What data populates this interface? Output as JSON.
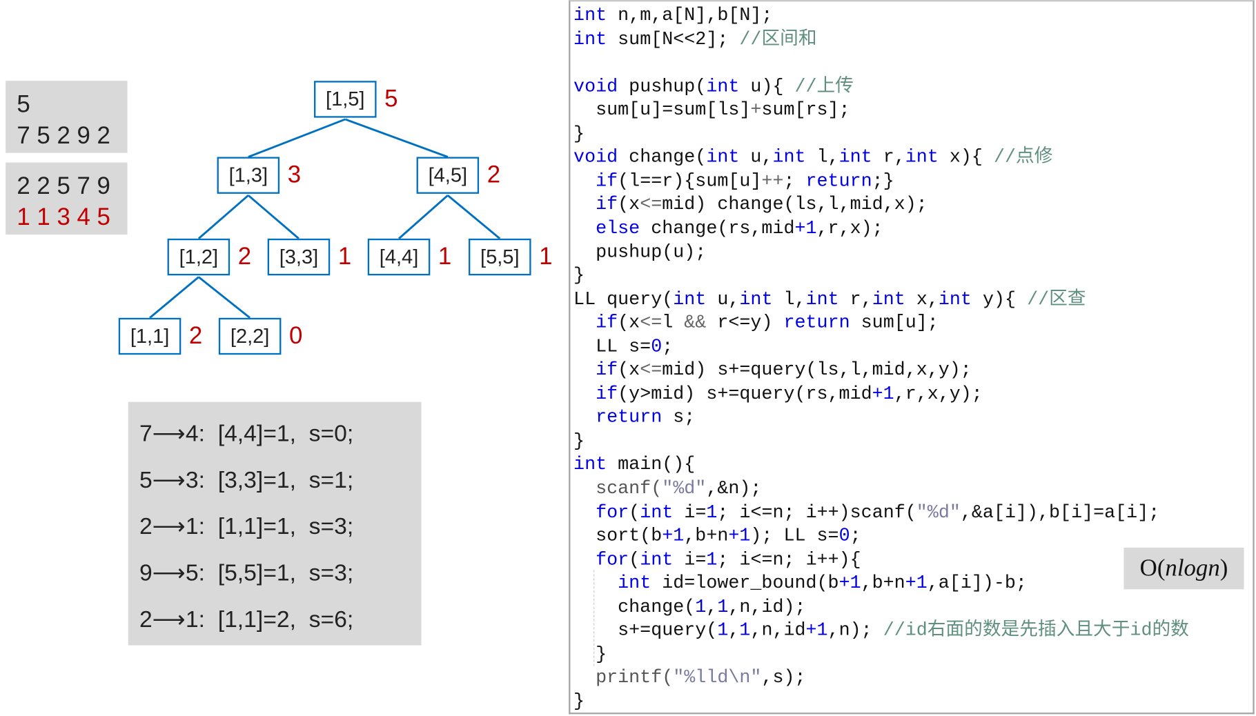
{
  "input": {
    "n": "5",
    "values": "7 5 2 9 2"
  },
  "sorted": {
    "values": "2 2 5 7 9",
    "ranks": "1 1 3 4 5"
  },
  "tree": {
    "colors": {
      "box": "#0070c0",
      "count": "#c00000"
    },
    "nodes": [
      {
        "range": "[1,5]",
        "count": "5"
      },
      {
        "range": "[1,3]",
        "count": "3"
      },
      {
        "range": "[4,5]",
        "count": "2"
      },
      {
        "range": "[1,2]",
        "count": "2"
      },
      {
        "range": "[3,3]",
        "count": "1"
      },
      {
        "range": "[4,4]",
        "count": "1"
      },
      {
        "range": "[5,5]",
        "count": "1"
      },
      {
        "range": "[1,1]",
        "count": "2"
      },
      {
        "range": "[2,2]",
        "count": "0"
      }
    ]
  },
  "steps": [
    "7⟶4:  [4,4]=1,  s=0;",
    "5⟶3:  [3,3]=1,  s=1;",
    "2⟶1:  [1,1]=1,  s=3;",
    "9⟶5:  [5,5]=1,  s=3;",
    "2⟶1:  [1,1]=2,  s=6;"
  ],
  "complexity": {
    "prefix": "O(",
    "italic": "nlogn",
    "suffix": ")"
  },
  "code": [
    [
      [
        "int",
        "k"
      ],
      [
        " n,m,a[N],b[N];",
        ""
      ]
    ],
    [
      [
        "int",
        "k"
      ],
      [
        " sum[N<<2]; ",
        ""
      ],
      [
        "//区间和",
        "c"
      ]
    ],
    [],
    [
      [
        "void",
        "k"
      ],
      [
        " pushup(",
        ""
      ],
      [
        "int",
        "k"
      ],
      [
        " u){ ",
        ""
      ],
      [
        "//上传",
        "c"
      ]
    ],
    [
      [
        "  sum[u]=sum[ls]",
        ""
      ],
      [
        "+",
        "o"
      ],
      [
        "sum[rs];",
        ""
      ]
    ],
    [
      [
        "}",
        ""
      ]
    ],
    [
      [
        "void",
        "k"
      ],
      [
        " change(",
        ""
      ],
      [
        "int",
        "k"
      ],
      [
        " u,",
        ""
      ],
      [
        "int",
        "k"
      ],
      [
        " l,",
        ""
      ],
      [
        "int",
        "k"
      ],
      [
        " r,",
        ""
      ],
      [
        "int",
        "k"
      ],
      [
        " x){ ",
        ""
      ],
      [
        "//点修",
        "c"
      ]
    ],
    [
      [
        "  ",
        ""
      ],
      [
        "if",
        "k"
      ],
      [
        "(l==r){sum[u]",
        ""
      ],
      [
        "++",
        "o"
      ],
      [
        "; ",
        ""
      ],
      [
        "return",
        "k"
      ],
      [
        ";}",
        ""
      ]
    ],
    [
      [
        "  ",
        ""
      ],
      [
        "if",
        "k"
      ],
      [
        "(x",
        ""
      ],
      [
        "<=",
        "o"
      ],
      [
        "mid) change(ls,l,mid,x);",
        ""
      ]
    ],
    [
      [
        "  ",
        ""
      ],
      [
        "else",
        "k"
      ],
      [
        " change(rs,mid",
        ""
      ],
      [
        "+1",
        "n"
      ],
      [
        ",r,x);",
        ""
      ]
    ],
    [
      [
        "  pushup(u);",
        ""
      ]
    ],
    [
      [
        "}",
        ""
      ]
    ],
    [
      [
        "LL query(",
        ""
      ],
      [
        "int",
        "k"
      ],
      [
        " u,",
        ""
      ],
      [
        "int",
        "k"
      ],
      [
        " l,",
        ""
      ],
      [
        "int",
        "k"
      ],
      [
        " r,",
        ""
      ],
      [
        "int",
        "k"
      ],
      [
        " x,",
        ""
      ],
      [
        "int",
        "k"
      ],
      [
        " y){ ",
        ""
      ],
      [
        "//区查",
        "c"
      ]
    ],
    [
      [
        "  ",
        ""
      ],
      [
        "if",
        "k"
      ],
      [
        "(x",
        ""
      ],
      [
        "<=",
        "o"
      ],
      [
        "l ",
        ""
      ],
      [
        "&&",
        "o"
      ],
      [
        " r<=y) ",
        ""
      ],
      [
        "return",
        "k"
      ],
      [
        " sum[u];",
        ""
      ]
    ],
    [
      [
        "  LL s=",
        ""
      ],
      [
        "0",
        "n"
      ],
      [
        ";",
        ""
      ]
    ],
    [
      [
        "  ",
        ""
      ],
      [
        "if",
        "k"
      ],
      [
        "(x",
        ""
      ],
      [
        "<=",
        "o"
      ],
      [
        "mid) s+=query(ls,l,mid,x,y);",
        ""
      ]
    ],
    [
      [
        "  ",
        ""
      ],
      [
        "if",
        "k"
      ],
      [
        "(y>mid) s+=query(rs,mid",
        ""
      ],
      [
        "+1",
        "n"
      ],
      [
        ",r,x,y);",
        ""
      ]
    ],
    [
      [
        "  ",
        ""
      ],
      [
        "return",
        "k"
      ],
      [
        " s;",
        ""
      ]
    ],
    [
      [
        "}",
        ""
      ]
    ],
    [
      [
        "int",
        "k"
      ],
      [
        " main(){",
        ""
      ]
    ],
    [
      [
        "  scanf(",
        "f"
      ],
      [
        "\"%d\"",
        "s"
      ],
      [
        ",&n);",
        ""
      ]
    ],
    [
      [
        "  ",
        ""
      ],
      [
        "for",
        "k"
      ],
      [
        "(",
        ""
      ],
      [
        "int",
        "k"
      ],
      [
        " i=",
        ""
      ],
      [
        "1",
        "n"
      ],
      [
        "; i<=n; i++)scanf(",
        ""
      ],
      [
        "\"%d\"",
        "s"
      ],
      [
        ",&a[i]),b[i]=a[i];",
        ""
      ]
    ],
    [
      [
        "  sort(b",
        ""
      ],
      [
        "+1",
        "n"
      ],
      [
        ",b+n",
        ""
      ],
      [
        "+1",
        "n"
      ],
      [
        "); LL s=",
        ""
      ],
      [
        "0",
        "n"
      ],
      [
        ";",
        ""
      ]
    ],
    [
      [
        "  ",
        ""
      ],
      [
        "for",
        "k"
      ],
      [
        "(",
        ""
      ],
      [
        "int",
        "k"
      ],
      [
        " i=",
        ""
      ],
      [
        "1",
        "n"
      ],
      [
        "; i<=n; i++){",
        ""
      ]
    ],
    [
      [
        "    ",
        ""
      ],
      [
        "int",
        "k"
      ],
      [
        " id=lower_bound(b",
        ""
      ],
      [
        "+1",
        "n"
      ],
      [
        ",b+n",
        ""
      ],
      [
        "+1",
        "n"
      ],
      [
        ",a[i])-b;",
        ""
      ]
    ],
    [
      [
        "    change(",
        ""
      ],
      [
        "1",
        "n"
      ],
      [
        ",",
        ""
      ],
      [
        "1",
        "n"
      ],
      [
        ",n,id);",
        ""
      ]
    ],
    [
      [
        "    s+=query(",
        ""
      ],
      [
        "1",
        "n"
      ],
      [
        ",",
        ""
      ],
      [
        "1",
        "n"
      ],
      [
        ",n,id",
        ""
      ],
      [
        "+1",
        "n"
      ],
      [
        ",n); ",
        ""
      ],
      [
        "//id右面的数是先插入且大于id的数",
        "c"
      ]
    ],
    [
      [
        "  }",
        ""
      ]
    ],
    [
      [
        "  printf(",
        "f"
      ],
      [
        "\"%lld\\n\"",
        "s"
      ],
      [
        ",s);",
        ""
      ]
    ],
    [
      [
        "}",
        ""
      ]
    ]
  ]
}
